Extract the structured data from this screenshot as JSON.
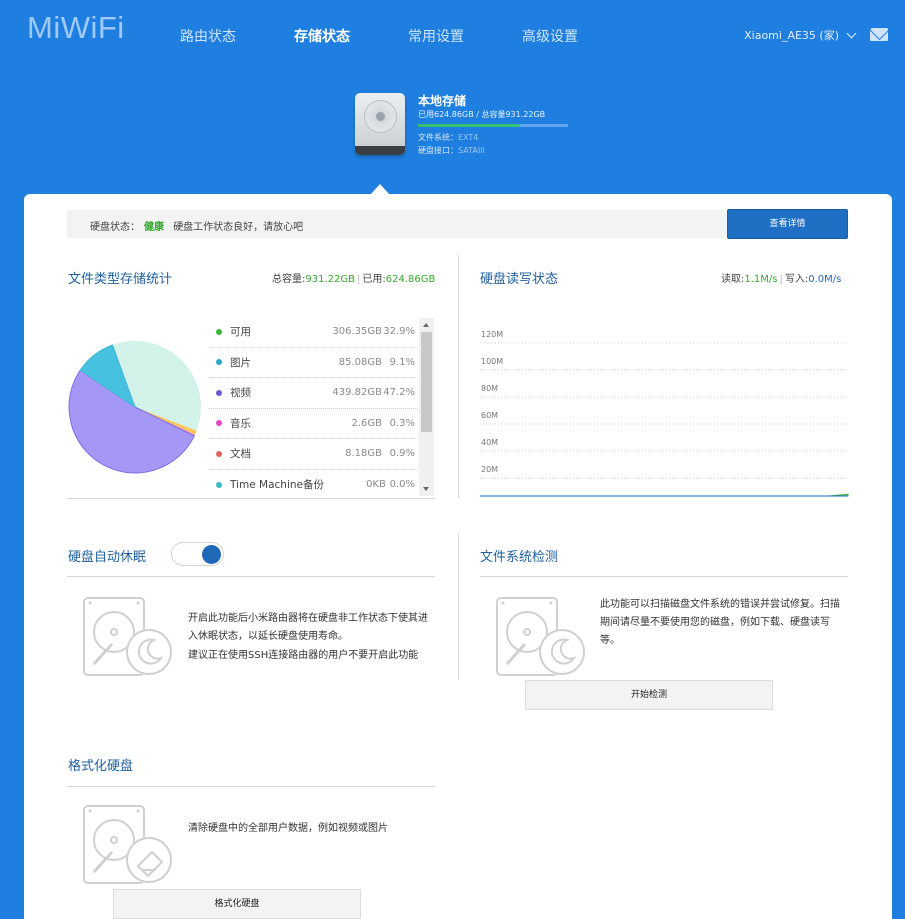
{
  "brand": {
    "logo": "MiWiFi"
  },
  "nav": {
    "items": [
      {
        "label": "路由状态"
      },
      {
        "label": "存储状态"
      },
      {
        "label": "常用设置"
      },
      {
        "label": "高级设置"
      }
    ],
    "user_label": "Xiaomi_AE35 (家)"
  },
  "storage": {
    "title": "本地存储",
    "used_text": "已用624.86GB / 总容量931.22GB",
    "used_fraction": 0.671,
    "fs_label": "文件系统：",
    "fs_value": "EXT4",
    "port_label": "硬盘接口：",
    "port_value": "SATAIII"
  },
  "status": {
    "label": "硬盘状态：",
    "value": "健康",
    "message": "硬盘工作状态良好，请放心吧",
    "detail_button": "查看详情"
  },
  "file_stats": {
    "title": "文件类型存储统计",
    "total_label": "总容量:",
    "total_value": "931.22GB",
    "used_label": "已用:",
    "used_value": "624.86GB",
    "items": [
      {
        "name": "可用",
        "size": "306.35GB",
        "pct": "32.9%",
        "color": "#3db43c"
      },
      {
        "name": "图片",
        "size": "85.08GB",
        "pct": "9.1%",
        "color": "#2aa6c9"
      },
      {
        "name": "视频",
        "size": "439.82GB",
        "pct": "47.2%",
        "color": "#6b5bd3"
      },
      {
        "name": "音乐",
        "size": "2.6GB",
        "pct": "0.3%",
        "color": "#e649c6"
      },
      {
        "name": "文档",
        "size": "8.18GB",
        "pct": "0.9%",
        "color": "#e0645e"
      },
      {
        "name": "Time Machine备份",
        "size": "0KB",
        "pct": "0.0%",
        "color": "#3fbcc2"
      }
    ],
    "pie_colors": [
      "#d2f2ea",
      "#ffc558",
      "#ff95c1",
      "#a497f6",
      "#47c1e0"
    ]
  },
  "rw_status": {
    "title": "硬盘读写状态",
    "read_label": "读取:",
    "read_value": "1.1M/s",
    "write_label": "写入:",
    "write_value": "0.0M/s"
  },
  "chart_data": {
    "type": "area",
    "title": "硬盘读写状态",
    "xlabel": "",
    "ylabel": "",
    "y_ticks": [
      "20M",
      "40M",
      "60M",
      "80M",
      "100M",
      "120M"
    ],
    "ylim": [
      0,
      120
    ],
    "grid": true,
    "series": [
      {
        "name": "读取",
        "values": [
          0,
          0,
          0,
          0,
          0,
          0,
          0,
          0,
          0,
          0,
          0,
          0,
          0,
          0,
          0,
          0,
          0,
          0,
          0,
          1.1
        ],
        "color": "#3db43c"
      },
      {
        "name": "写入",
        "values": [
          0,
          0,
          0,
          0,
          0,
          0,
          0,
          0,
          0,
          0,
          0,
          0,
          0,
          0,
          0,
          0,
          0,
          0,
          0,
          0
        ],
        "color": "#2069b9"
      }
    ]
  },
  "sleep": {
    "title": "硬盘自动休眠",
    "enabled": true,
    "desc1": "开启此功能后小米路由器将在硬盘非工作状态下使其进入休眠状态，以延长硬盘使用寿命。",
    "desc2": "建议正在使用SSH连接路由器的用户不要开启此功能"
  },
  "fscheck": {
    "title": "文件系统检测",
    "desc": "此功能可以扫描磁盘文件系统的错误并尝试修复。扫描期间请尽量不要使用您的磁盘，例如下载、硬盘读写等。",
    "button": "开始检测"
  },
  "format": {
    "title": "格式化硬盘",
    "desc": "清除硬盘中的全部用户数据，例如视频或图片",
    "button": "格式化硬盘"
  }
}
